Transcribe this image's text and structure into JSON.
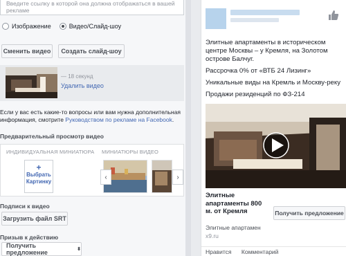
{
  "editor": {
    "top_text": "Введите ссылку в которой она должна отображаться в вашей рекламе",
    "format_options": [
      {
        "label": "Изображение",
        "selected": false
      },
      {
        "label": "Видео/Слайд-шоу",
        "selected": true
      }
    ],
    "change_video_label": "Сменить видео",
    "create_slideshow_label": "Создать слайд-шоу",
    "video_duration": "18 секунд",
    "remove_video_label": "Удалить видео",
    "help_text_prefix": "Если у вас есть какие-то вопросы или вам нужна дополнительная информация, смотрите ",
    "help_link": "Руководством по рекламе на Facebook",
    "help_text_suffix": ".",
    "preview_label": "Предварительный просмотр видео",
    "tab_custom": "Индивидуальная миниатюра",
    "tab_thumbs": "Миниатюры видео",
    "choose_picture_label": "Выбрать Картинку",
    "captions_label": "Подписи к видео",
    "upload_srt_label": "Загрузить файл SRT",
    "cta_label": "Призыв к действию",
    "cta_select_value": "Получить предложение"
  },
  "ad_preview": {
    "lines": [
      "Элитные апартаменты в историческом центре Москвы – у Кремля, на Золотом острове Балчуг.",
      "Рассрочка 0% от «ВТБ 24 Лизинг»",
      "Уникальные виды на Кремль и Москву-реку",
      "Продажи резиденций по ФЗ-214"
    ],
    "link_title": "Элитные апартаменты 800 м. от Кремля",
    "link_description": "Элитные апартамен",
    "link_url": "x9.ru",
    "offer_button": "Получить предложение",
    "like_label": "Нравится",
    "comment_label": "Комментарий"
  },
  "colors": {
    "link": "#4267b2",
    "panel_bg": "#f6f7f9",
    "play_button": "#ffffff"
  }
}
